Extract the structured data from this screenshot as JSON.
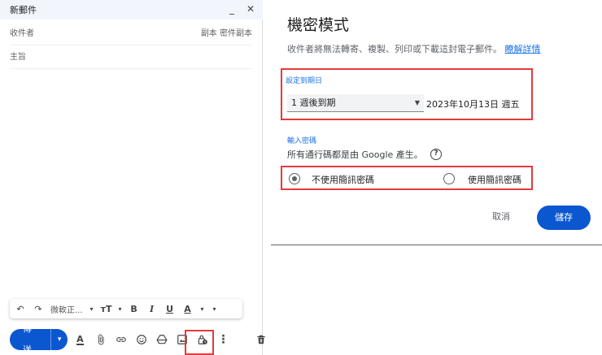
{
  "compose": {
    "title": "新郵件",
    "minimize_glyph": "_",
    "close_glyph": "✕",
    "to_label": "收件者",
    "cc_bcc": "副本 密件副本",
    "subject_label": "主旨",
    "toolbar": {
      "undo_glyph": "↶",
      "redo_glyph": "↷",
      "font": "微軟正...",
      "size_glyph": "тT",
      "bold": "B",
      "italic": "I",
      "underline": "U",
      "text_color": "A",
      "dropdown": "▾"
    },
    "send_label": "傳送",
    "send_arrow": "▾",
    "format_letter": "A",
    "more_glyph": "⋮"
  },
  "dialog": {
    "title": "機密模式",
    "description": "收件者將無法轉寄、複製、列印或下載這封電子郵件。",
    "learn_more": "瞭解詳情",
    "expiry_label": "設定到期日",
    "expiry_value": "1 週後到期",
    "expiry_date": "2023年10月13日 週五",
    "password_label": "輸入密碼",
    "password_desc": "所有通行碼都是由 Google 產生。",
    "help_glyph": "?",
    "option_no_sms": "不使用簡訊密碼",
    "option_sms": "使用簡訊密碼",
    "cancel_label": "取消",
    "save_label": "儲存"
  },
  "colors": {
    "primary": "#0b57d0",
    "link": "#1a73e8",
    "highlight": "#e33b3b"
  },
  "icons": [
    "undo-icon",
    "redo-icon",
    "attach-icon",
    "link-icon",
    "emoji-icon",
    "drive-icon",
    "photo-icon",
    "lock-clock-icon",
    "more-icon",
    "trash-icon"
  ]
}
